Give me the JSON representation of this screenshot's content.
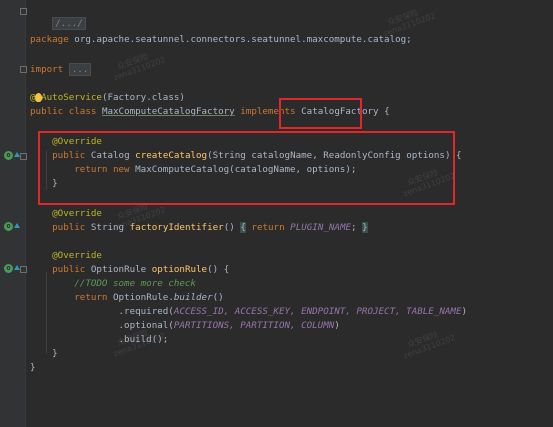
{
  "editor": {
    "header_fold": "/.../",
    "package_kw": "package",
    "package_name": "org.apache.seatunnel.connectors.seatunnel.maxcompute.catalog;",
    "import_kw": "import",
    "import_fold": "...",
    "autoservice_at": "@",
    "autoservice_name": "AutoService",
    "autoservice_arg": "(Factory.class)",
    "class_modifiers": "public class",
    "class_name": "MaxComputeCatalogFactory",
    "implements_kw": "implements",
    "interface_name": "CatalogFactory",
    "open_brace": "{",
    "override1": "@Override",
    "m1_public": "public",
    "m1_return_type": "Catalog",
    "m1_name": "createCatalog",
    "m1_params": "(String catalogName, ReadonlyConfig options) {",
    "m1_return_kw": "return new",
    "m1_body": "MaxComputeCatalog(catalogName, options);",
    "m1_close": "}",
    "override2": "@Override",
    "m2_public": "public",
    "m2_type": "String",
    "m2_name": "factoryIdentifier",
    "m2_parens": "()",
    "m2_open": "{",
    "m2_return_kw": "return",
    "m2_value": "PLUGIN_NAME",
    "m2_semicolon": ";",
    "m2_close": "}",
    "override3": "@Override",
    "m3_public": "public",
    "m3_type": "OptionRule",
    "m3_name": "optionRule",
    "m3_parens": "() {",
    "todo_comment": "//TODO some more check",
    "m3_return_kw": "return",
    "m3_builder_prefix": "OptionRule.",
    "m3_builder": "builder",
    "m3_builder_suffix": "()",
    "required_prefix": ".required(",
    "required_args": "ACCESS_ID, ACCESS_KEY, ENDPOINT, PROJECT, TABLE_NAME",
    "required_suffix": ")",
    "optional_prefix": ".optional(",
    "optional_args": "PARTITIONS, PARTITION, COLUMN",
    "optional_suffix": ")",
    "build_call": ".build();",
    "m3_close": "}",
    "class_close": "}"
  },
  "gutter": {
    "impl_icon": "implements-method-icon",
    "override_arrow": "override-arrow-icon"
  },
  "colors": {
    "background": "#2b2b2b",
    "keyword": "#cc7832",
    "annotation": "#bbb529",
    "method": "#ffc66d",
    "static_field": "#9876aa",
    "comment": "#629755",
    "highlight_box": "#e0282a"
  }
}
